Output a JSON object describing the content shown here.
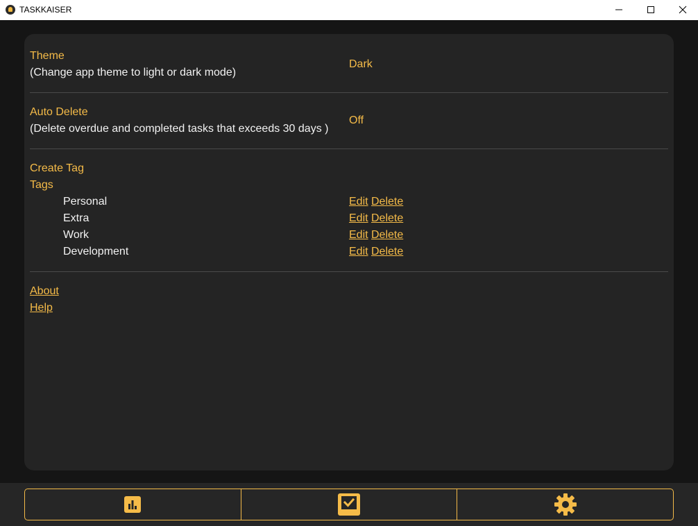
{
  "window": {
    "title": "TASKKAISER"
  },
  "settings": {
    "theme": {
      "label": "Theme",
      "description": "(Change app theme to light or dark mode)",
      "value": "Dark"
    },
    "auto_delete": {
      "label": "Auto Delete",
      "description": "(Delete overdue and completed tasks that exceeds 30 days )",
      "value": "Off"
    },
    "tags": {
      "create_label": "Create Tag",
      "heading": "Tags",
      "edit_label": "Edit",
      "delete_label": "Delete",
      "items": [
        {
          "name": "Personal"
        },
        {
          "name": "Extra"
        },
        {
          "name": "Work"
        },
        {
          "name": "Development"
        }
      ]
    },
    "links": {
      "about": "About",
      "help": "Help"
    }
  },
  "nav": {
    "items": [
      {
        "icon": "bar-chart-icon"
      },
      {
        "icon": "task-inbox-icon"
      },
      {
        "icon": "gear-icon"
      }
    ]
  },
  "colors": {
    "accent": "#f5bb48",
    "background": "#151515",
    "panel": "#242424",
    "text": "#f2f2f2"
  }
}
